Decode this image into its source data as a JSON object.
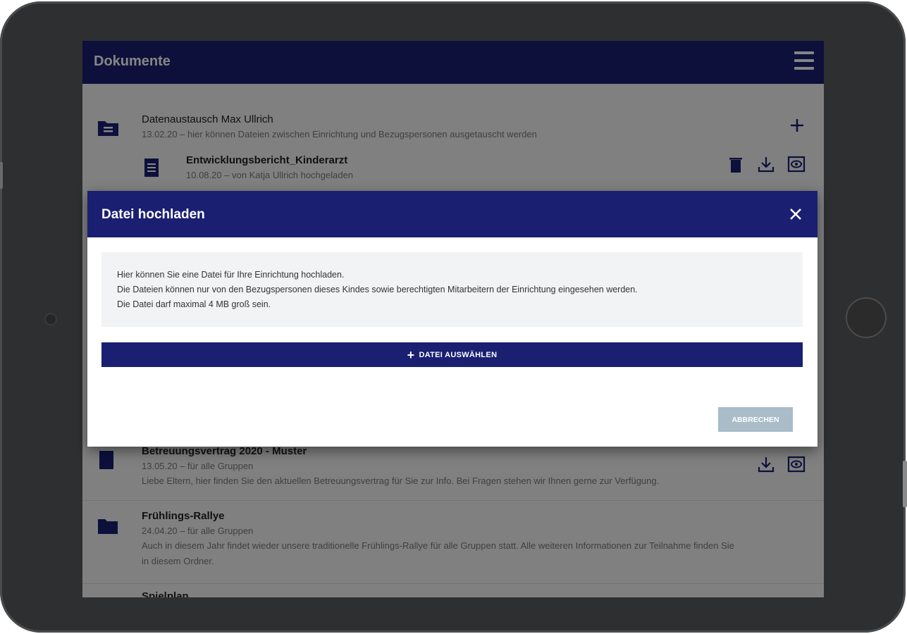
{
  "app": {
    "title": "Dokumente"
  },
  "documents": [
    {
      "title": "Datenaustausch Max Ullrich",
      "meta": "13.02.20 – hier können Dateien zwischen Einrichtung und Bezugspersonen ausgetauscht werden"
    },
    {
      "title": "Entwicklungsbericht_Kinderarzt",
      "meta": "10.08.20 – von Katja Ullrich hochgeladen"
    },
    {
      "title": "Betreuungsvertrag 2020 - Muster",
      "meta": "13.05.20 – für alle Gruppen",
      "desc": "Liebe Eltern, hier finden Sie den aktuellen Betreuungsvertrag für Sie zur Info. Bei Fragen stehen wir Ihnen gerne zur Verfügung."
    },
    {
      "title": "Frühlings-Rallye",
      "meta": "24.04.20 – für alle Gruppen",
      "desc1": "Auch in diesem Jahr findet wieder unsere traditionelle Frühlings-Rallye für alle Gruppen statt. Alle weiteren Informationen zur Teilnahme finden Sie",
      "desc2": "in diesem Ordner."
    },
    {
      "title": "Spielplan"
    }
  ],
  "dialog": {
    "title": "Datei hochladen",
    "info": [
      "Hier können Sie eine Datei für Ihre Einrichtung hochladen.",
      "Die Dateien können nur von den Bezugspersonen dieses Kindes sowie berechtigten Mitarbeitern der Einrichtung eingesehen werden.",
      "Die Datei darf maximal 4 MB groß sein."
    ],
    "select_label": "DATEI AUSWÄHLEN",
    "cancel_label": "ABBRECHEN"
  },
  "colors": {
    "primary": "#1a1f71",
    "cancel": "#a9bcc8"
  },
  "icons": [
    "menu-icon",
    "folder-shared-icon",
    "add-icon",
    "document-icon",
    "delete-icon",
    "download-icon",
    "view-icon",
    "folder-icon",
    "close-icon"
  ]
}
